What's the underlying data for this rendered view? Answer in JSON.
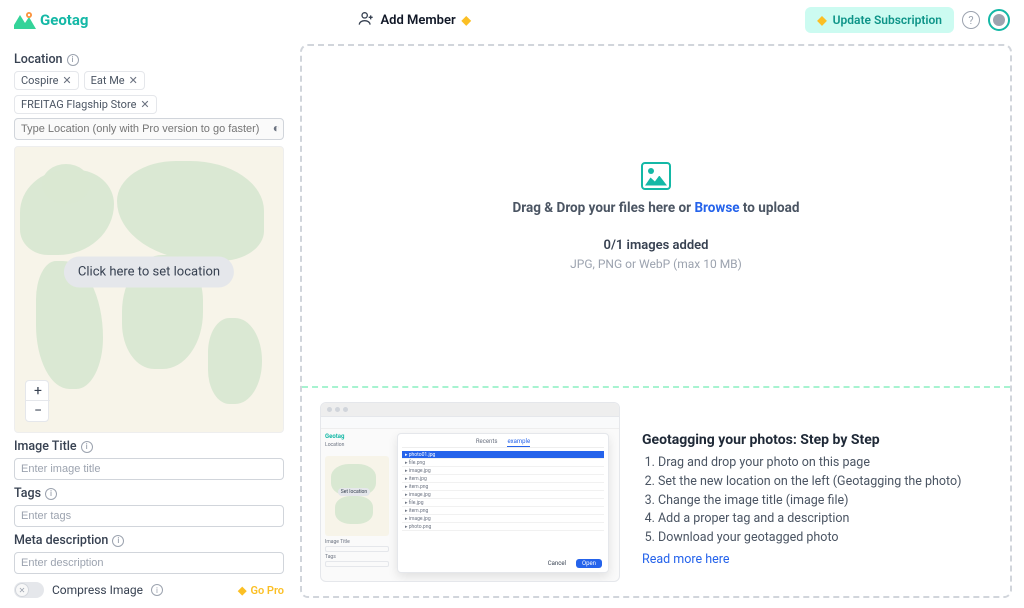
{
  "brand": "Geotag",
  "header": {
    "add_member": "Add Member",
    "update_subscription": "Update Subscription"
  },
  "sidebar": {
    "location_label": "Location",
    "chips": [
      "Cospire",
      "Eat Me",
      "FREITAG Flagship Store"
    ],
    "location_placeholder": "Type Location (only with Pro version to go faster)",
    "map_cta": "Click here to set location",
    "image_title_label": "Image Title",
    "image_title_placeholder": "Enter image title",
    "tags_label": "Tags",
    "tags_placeholder": "Enter tags",
    "meta_label": "Meta description",
    "meta_placeholder": "Enter description",
    "compress_label": "Compress Image",
    "gopro": "Go Pro"
  },
  "main": {
    "drop_prefix": "Drag & Drop your files here or ",
    "browse": "Browse",
    "drop_suffix": " to upload",
    "count": "0/1 images added",
    "hint": "JPG, PNG or WebP (max 10 MB)",
    "help_title": "Geotagging your photos: Step by Step",
    "steps": [
      "Drag and drop your photo on this page",
      "Set the new location on the left (Geotagging the photo)",
      "Change the image title (image file)",
      "Add a proper tag and a description",
      "Download your geotagged photo"
    ],
    "read_more": "Read more here"
  }
}
